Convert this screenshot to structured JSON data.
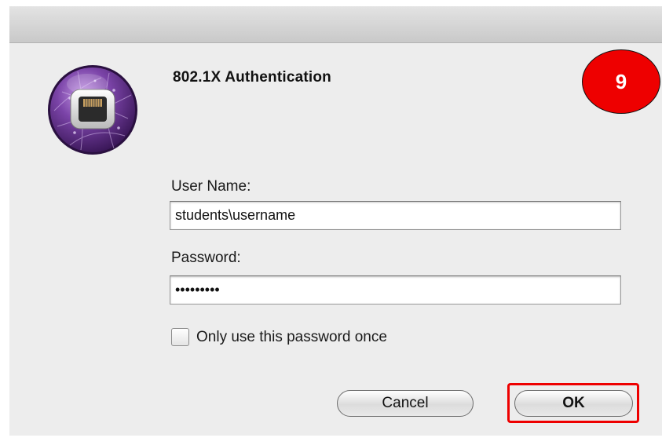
{
  "dialog": {
    "title": "802.1X Authentication",
    "icon": "network-ethernet-icon",
    "step_badge": "9"
  },
  "form": {
    "username_label": "User Name:",
    "username_value": "students\\username",
    "password_label": "Password:",
    "password_masked": "•••••••••",
    "once_label": "Only use this password once",
    "once_checked": false
  },
  "buttons": {
    "cancel_label": "Cancel",
    "ok_label": "OK"
  },
  "colors": {
    "badge": "#ee0000",
    "highlight": "#ee0000",
    "icon_purple": "#6b3b94"
  }
}
